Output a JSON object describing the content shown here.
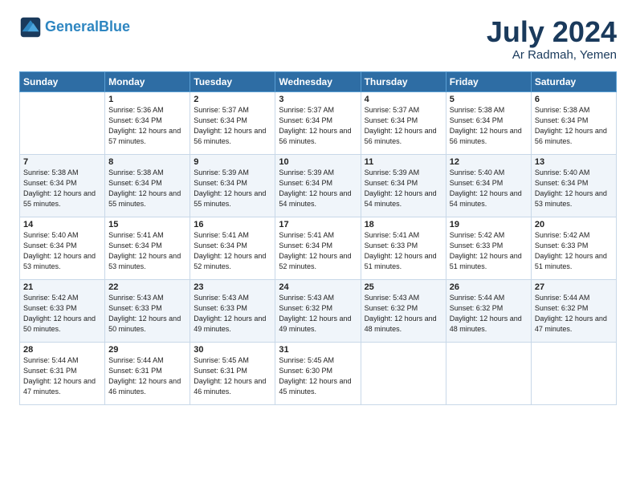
{
  "header": {
    "logo_line1": "General",
    "logo_line2": "Blue",
    "month": "July 2024",
    "location": "Ar Radmah, Yemen"
  },
  "weekdays": [
    "Sunday",
    "Monday",
    "Tuesday",
    "Wednesday",
    "Thursday",
    "Friday",
    "Saturday"
  ],
  "weeks": [
    [
      {
        "day": "",
        "info": ""
      },
      {
        "day": "1",
        "info": "Sunrise: 5:36 AM\nSunset: 6:34 PM\nDaylight: 12 hours\nand 57 minutes."
      },
      {
        "day": "2",
        "info": "Sunrise: 5:37 AM\nSunset: 6:34 PM\nDaylight: 12 hours\nand 56 minutes."
      },
      {
        "day": "3",
        "info": "Sunrise: 5:37 AM\nSunset: 6:34 PM\nDaylight: 12 hours\nand 56 minutes."
      },
      {
        "day": "4",
        "info": "Sunrise: 5:37 AM\nSunset: 6:34 PM\nDaylight: 12 hours\nand 56 minutes."
      },
      {
        "day": "5",
        "info": "Sunrise: 5:38 AM\nSunset: 6:34 PM\nDaylight: 12 hours\nand 56 minutes."
      },
      {
        "day": "6",
        "info": "Sunrise: 5:38 AM\nSunset: 6:34 PM\nDaylight: 12 hours\nand 56 minutes."
      }
    ],
    [
      {
        "day": "7",
        "info": "Sunrise: 5:38 AM\nSunset: 6:34 PM\nDaylight: 12 hours\nand 55 minutes."
      },
      {
        "day": "8",
        "info": "Sunrise: 5:38 AM\nSunset: 6:34 PM\nDaylight: 12 hours\nand 55 minutes."
      },
      {
        "day": "9",
        "info": "Sunrise: 5:39 AM\nSunset: 6:34 PM\nDaylight: 12 hours\nand 55 minutes."
      },
      {
        "day": "10",
        "info": "Sunrise: 5:39 AM\nSunset: 6:34 PM\nDaylight: 12 hours\nand 54 minutes."
      },
      {
        "day": "11",
        "info": "Sunrise: 5:39 AM\nSunset: 6:34 PM\nDaylight: 12 hours\nand 54 minutes."
      },
      {
        "day": "12",
        "info": "Sunrise: 5:40 AM\nSunset: 6:34 PM\nDaylight: 12 hours\nand 54 minutes."
      },
      {
        "day": "13",
        "info": "Sunrise: 5:40 AM\nSunset: 6:34 PM\nDaylight: 12 hours\nand 53 minutes."
      }
    ],
    [
      {
        "day": "14",
        "info": "Sunrise: 5:40 AM\nSunset: 6:34 PM\nDaylight: 12 hours\nand 53 minutes."
      },
      {
        "day": "15",
        "info": "Sunrise: 5:41 AM\nSunset: 6:34 PM\nDaylight: 12 hours\nand 53 minutes."
      },
      {
        "day": "16",
        "info": "Sunrise: 5:41 AM\nSunset: 6:34 PM\nDaylight: 12 hours\nand 52 minutes."
      },
      {
        "day": "17",
        "info": "Sunrise: 5:41 AM\nSunset: 6:34 PM\nDaylight: 12 hours\nand 52 minutes."
      },
      {
        "day": "18",
        "info": "Sunrise: 5:41 AM\nSunset: 6:33 PM\nDaylight: 12 hours\nand 51 minutes."
      },
      {
        "day": "19",
        "info": "Sunrise: 5:42 AM\nSunset: 6:33 PM\nDaylight: 12 hours\nand 51 minutes."
      },
      {
        "day": "20",
        "info": "Sunrise: 5:42 AM\nSunset: 6:33 PM\nDaylight: 12 hours\nand 51 minutes."
      }
    ],
    [
      {
        "day": "21",
        "info": "Sunrise: 5:42 AM\nSunset: 6:33 PM\nDaylight: 12 hours\nand 50 minutes."
      },
      {
        "day": "22",
        "info": "Sunrise: 5:43 AM\nSunset: 6:33 PM\nDaylight: 12 hours\nand 50 minutes."
      },
      {
        "day": "23",
        "info": "Sunrise: 5:43 AM\nSunset: 6:33 PM\nDaylight: 12 hours\nand 49 minutes."
      },
      {
        "day": "24",
        "info": "Sunrise: 5:43 AM\nSunset: 6:32 PM\nDaylight: 12 hours\nand 49 minutes."
      },
      {
        "day": "25",
        "info": "Sunrise: 5:43 AM\nSunset: 6:32 PM\nDaylight: 12 hours\nand 48 minutes."
      },
      {
        "day": "26",
        "info": "Sunrise: 5:44 AM\nSunset: 6:32 PM\nDaylight: 12 hours\nand 48 minutes."
      },
      {
        "day": "27",
        "info": "Sunrise: 5:44 AM\nSunset: 6:32 PM\nDaylight: 12 hours\nand 47 minutes."
      }
    ],
    [
      {
        "day": "28",
        "info": "Sunrise: 5:44 AM\nSunset: 6:31 PM\nDaylight: 12 hours\nand 47 minutes."
      },
      {
        "day": "29",
        "info": "Sunrise: 5:44 AM\nSunset: 6:31 PM\nDaylight: 12 hours\nand 46 minutes."
      },
      {
        "day": "30",
        "info": "Sunrise: 5:45 AM\nSunset: 6:31 PM\nDaylight: 12 hours\nand 46 minutes."
      },
      {
        "day": "31",
        "info": "Sunrise: 5:45 AM\nSunset: 6:30 PM\nDaylight: 12 hours\nand 45 minutes."
      },
      {
        "day": "",
        "info": ""
      },
      {
        "day": "",
        "info": ""
      },
      {
        "day": "",
        "info": ""
      }
    ]
  ]
}
